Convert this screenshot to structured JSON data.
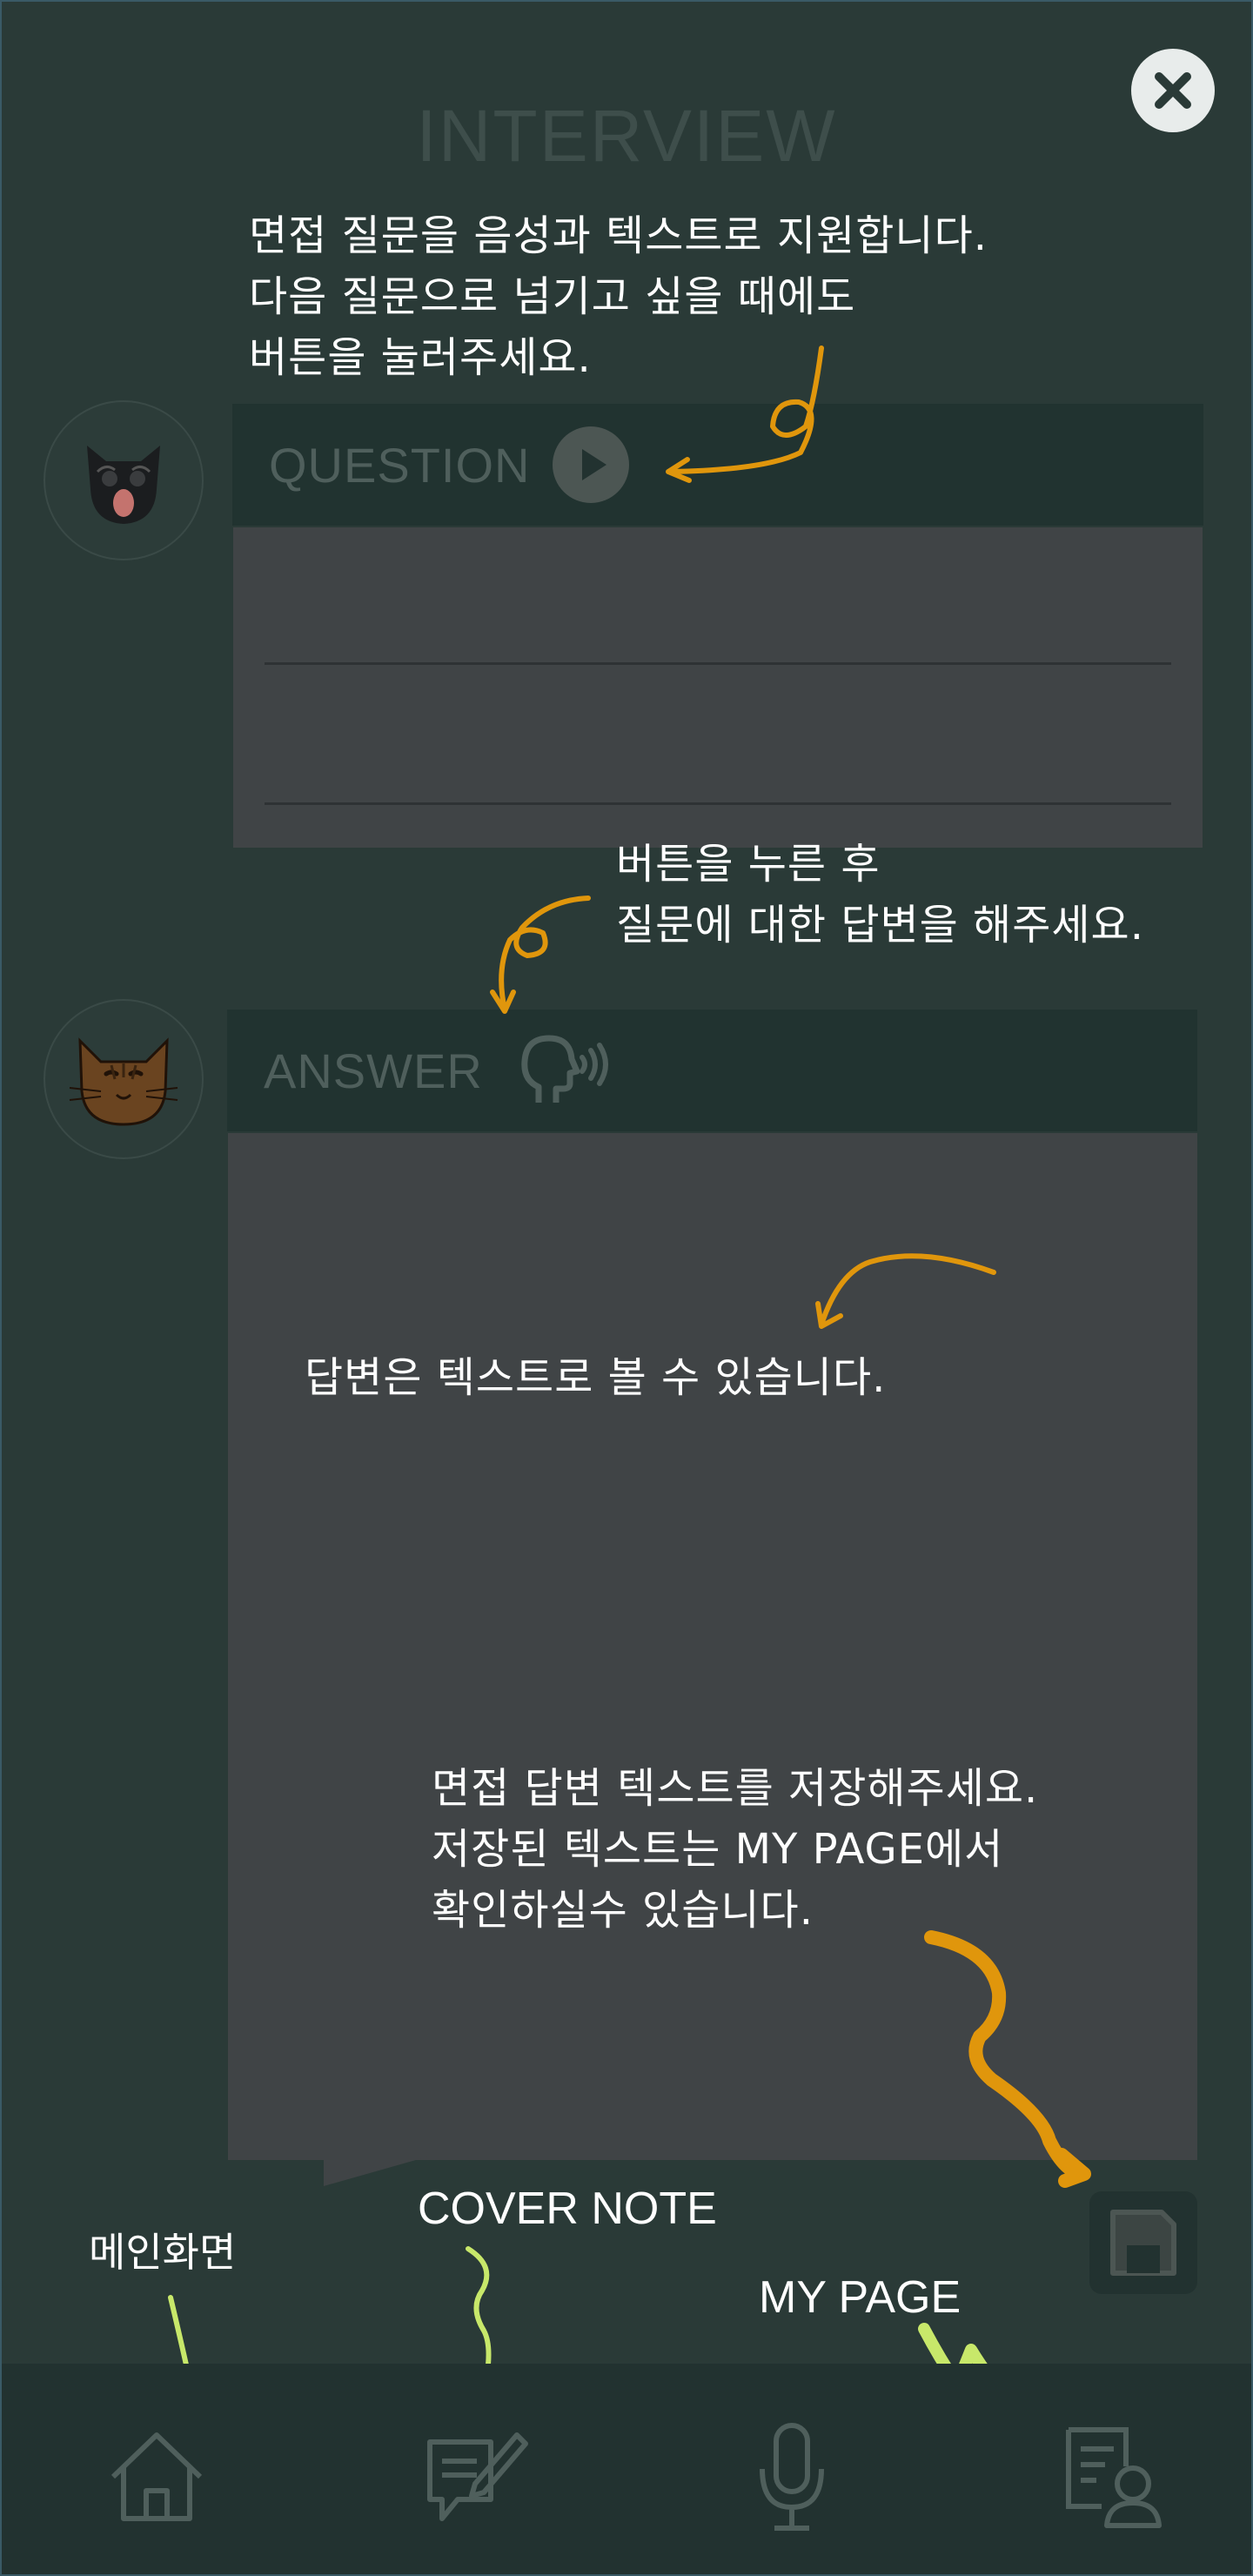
{
  "header": {
    "title": "INTERVIEW"
  },
  "question": {
    "header_label": "QUESTION"
  },
  "answer": {
    "header_label": "ANSWER"
  },
  "notes": {
    "question_help": "면접 질문을 음성과 텍스트로 지원합니다.\n다음 질문으로 넘기고 싶을 때에도\n버튼을 눌러주세요.",
    "answer_help": "버튼을 누른 후\n질문에 대한 답변을 해주세요.",
    "answer_text_help": "답변은 텍스트로 볼 수 있습니다.",
    "save_help": "면접 답변 텍스트를 저장해주세요.\n저장된 텍스트는 MY PAGE에서\n확인하실수 있습니다."
  },
  "nav_labels": {
    "home": "메인화면",
    "cover_note": "COVER NOTE",
    "my_page": "MY PAGE"
  },
  "colors": {
    "background": "#2a3a37",
    "panel_header": "#213330",
    "panel_body": "#404446",
    "arrow_orange": "#e0960c",
    "arrow_green": "#c8e86a"
  },
  "icons": [
    "close-icon",
    "play-icon",
    "speaking-head-icon",
    "save-icon",
    "home-icon",
    "note-edit-icon",
    "microphone-icon",
    "profile-document-icon"
  ]
}
